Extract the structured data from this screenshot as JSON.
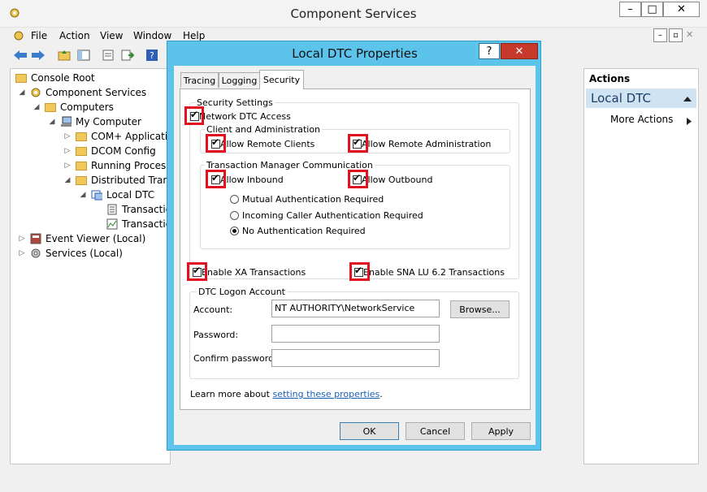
{
  "main": {
    "title": "Component Services",
    "buttons": {
      "minimize": "–",
      "maximize": "□",
      "close": "✕"
    },
    "child_buttons": {
      "minimize": "–",
      "restore": "▫",
      "close": "✕"
    },
    "menu": [
      "File",
      "Action",
      "View",
      "Window",
      "Help"
    ]
  },
  "tree": {
    "items": [
      {
        "label": "Console Root",
        "expander": "",
        "icon": "folder-icon"
      },
      {
        "label": "Component Services",
        "expander": "◢",
        "icon": "component-services-icon"
      },
      {
        "label": "Computers",
        "expander": "◢",
        "icon": "folder-icon"
      },
      {
        "label": "My Computer",
        "expander": "◢",
        "icon": "computer-icon"
      },
      {
        "label": "COM+ Applicatio",
        "expander": "▷",
        "icon": "folder-icon"
      },
      {
        "label": "DCOM Config",
        "expander": "▷",
        "icon": "folder-icon"
      },
      {
        "label": "Running Processe",
        "expander": "▷",
        "icon": "folder-icon"
      },
      {
        "label": "Distributed Trans",
        "expander": "◢",
        "icon": "folder-icon"
      },
      {
        "label": "Local DTC",
        "expander": "◢",
        "icon": "dtc-icon"
      },
      {
        "label": "Transactio",
        "expander": "",
        "icon": "list-icon"
      },
      {
        "label": "Transactio",
        "expander": "",
        "icon": "chart-icon"
      },
      {
        "label": "Event Viewer (Local)",
        "expander": "▷",
        "icon": "event-viewer-icon"
      },
      {
        "label": "Services (Local)",
        "expander": "▷",
        "icon": "services-icon"
      }
    ]
  },
  "actions": {
    "header": "Actions",
    "selected": "Local DTC",
    "more": "More Actions"
  },
  "dialog": {
    "title": "Local DTC Properties",
    "help": "?",
    "close": "✕",
    "tabs": [
      "Tracing",
      "Logging",
      "Security"
    ],
    "active_tab": "Security",
    "security_settings": {
      "group_label": "Security Settings",
      "network_dtc_access": "Network DTC Access",
      "client_admin_label": "Client and Administration",
      "allow_remote_clients": "Allow Remote Clients",
      "allow_remote_admin": "Allow Remote Administration",
      "tm_comm_label": "Transaction Manager Communication",
      "allow_inbound": "Allow Inbound",
      "allow_outbound": "Allow Outbound",
      "radio_mutual": "Mutual Authentication Required",
      "radio_incoming": "Incoming Caller Authentication Required",
      "radio_none": "No Authentication Required",
      "enable_xa": "Enable XA Transactions",
      "enable_sna": "Enable SNA LU 6.2 Transactions",
      "check": "✔"
    },
    "logon": {
      "group_label": "DTC Logon Account",
      "account_label": "Account:",
      "account_value": "NT AUTHORITY\\NetworkService",
      "browse": "Browse...",
      "password_label": "Password:",
      "confirm_label": "Confirm password:"
    },
    "learn_more_prefix": "Learn more about ",
    "learn_more_link": "setting these properties",
    "learn_more_suffix": ".",
    "ok": "OK",
    "cancel": "Cancel",
    "apply": "Apply"
  }
}
